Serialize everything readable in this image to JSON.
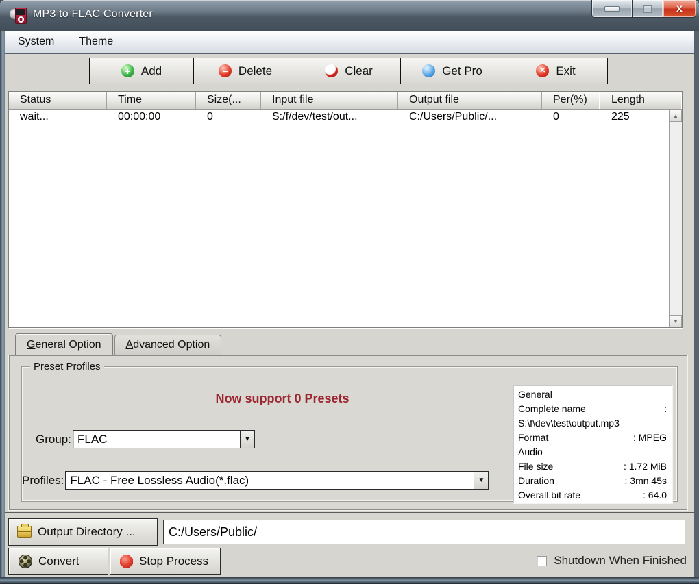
{
  "window": {
    "title": "MP3 to FLAC Converter",
    "controls": {
      "minimize": "minimize",
      "maximize": "maximize",
      "close_glyph": "x"
    }
  },
  "menu": {
    "items": [
      {
        "label": "System"
      },
      {
        "label": "Theme"
      }
    ]
  },
  "toolbar": {
    "buttons": [
      {
        "label": "Add",
        "icon": "add-icon",
        "glyph": "+"
      },
      {
        "label": "Delete",
        "icon": "delete-icon",
        "glyph": "−"
      },
      {
        "label": "Clear",
        "icon": "clear-icon",
        "glyph": ""
      },
      {
        "label": "Get Pro",
        "icon": "get-pro-icon",
        "glyph": ""
      },
      {
        "label": "Exit",
        "icon": "exit-icon",
        "glyph": "✕"
      }
    ]
  },
  "queue_table": {
    "columns": [
      "Status",
      "Time",
      "Size(...",
      "Input file",
      "Output file",
      "Per(%)",
      "Length"
    ],
    "rows": [
      [
        "wait...",
        "00:00:00",
        "0",
        "S:/f/dev/test/out...",
        "C:/Users/Public/...",
        "0",
        "225"
      ]
    ],
    "scroll_up_glyph": "▲",
    "scroll_down_glyph": "▼"
  },
  "tabs": [
    {
      "label": "General Option",
      "active": true
    },
    {
      "label": "Advanced Option",
      "active": false
    }
  ],
  "general_option": {
    "group_box_title": "Preset Profiles",
    "presets_message": "Now support 0 Presets",
    "group_label": "Group:",
    "group_value": "FLAC",
    "profiles_label": "Profiles:",
    "profiles_value": "FLAC - Free Lossless Audio(*.flac)",
    "combo_arrow_glyph": "▼",
    "media_info": {
      "lines": [
        {
          "label": "General",
          "value": ""
        },
        {
          "label": "Complete name",
          "value": ":"
        },
        {
          "label": "S:\\f\\dev\\test\\output.mp3",
          "value": ""
        },
        {
          "label": "Format",
          "value": ": MPEG"
        },
        {
          "label": "Audio",
          "value": ""
        },
        {
          "label": "File size",
          "value": ": 1.72 MiB"
        },
        {
          "label": "Duration",
          "value": ": 3mn 45s"
        },
        {
          "label": "Overall bit rate",
          "value": ": 64.0"
        }
      ]
    }
  },
  "output": {
    "button_label": "Output Directory ...",
    "path_value": "C:/Users/Public/"
  },
  "actions": {
    "convert_label": "Convert",
    "stop_label": "Stop Process",
    "shutdown_label": "Shutdown When Finished",
    "shutdown_checked": false
  },
  "colors": {
    "presets_message_text": "#9b2531",
    "titlebar": "#56626d",
    "client_background": "#d7d5cf",
    "close_button": "#c8331c"
  }
}
